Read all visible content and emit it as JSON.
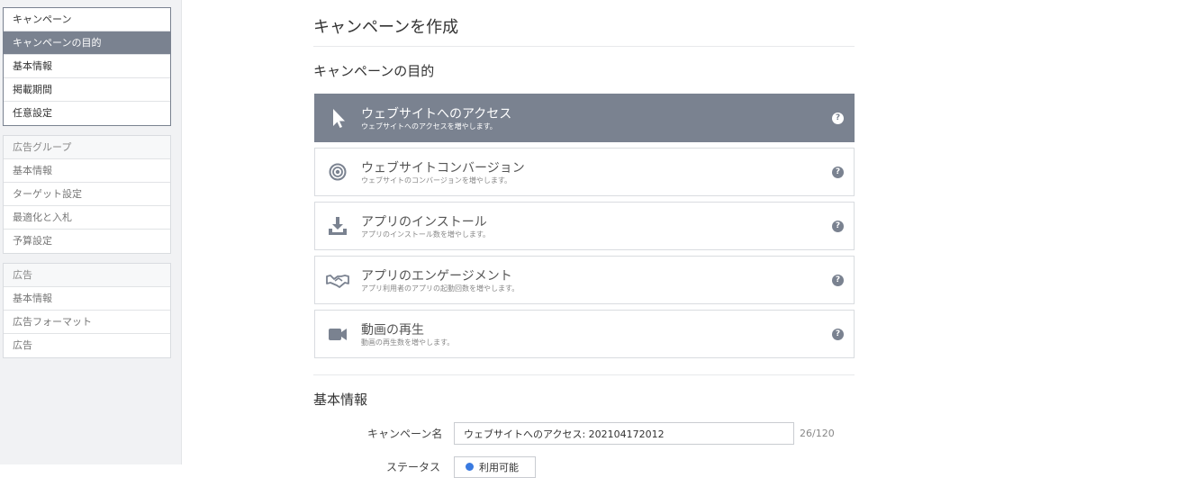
{
  "sidebar": {
    "campaign": [
      "キャンペーン",
      "キャンペーンの目的",
      "基本情報",
      "掲載期間",
      "任意設定"
    ],
    "adgroup": [
      "広告グループ",
      "基本情報",
      "ターゲット設定",
      "最適化と入札",
      "予算設定"
    ],
    "ad": [
      "広告",
      "基本情報",
      "広告フォーマット",
      "広告"
    ]
  },
  "main": {
    "page_title": "キャンペーンを作成",
    "objective_section_title": "キャンペーンの目的",
    "objectives": [
      {
        "title": "ウェブサイトへのアクセス",
        "desc": "ウェブサイトへのアクセスを増やします。",
        "icon": "cursor-icon",
        "selected": true
      },
      {
        "title": "ウェブサイトコンバージョン",
        "desc": "ウェブサイトのコンバージョンを増やします。",
        "icon": "target-icon",
        "selected": false
      },
      {
        "title": "アプリのインストール",
        "desc": "アプリのインストール数を増やします。",
        "icon": "download-icon",
        "selected": false
      },
      {
        "title": "アプリのエンゲージメント",
        "desc": "アプリ利用者のアプリの起動回数を増やします。",
        "icon": "handshake-icon",
        "selected": false
      },
      {
        "title": "動画の再生",
        "desc": "動画の再生数を増やします。",
        "icon": "video-camera-icon",
        "selected": false
      }
    ],
    "help_glyph": "?",
    "basic_section_title": "基本情報",
    "campaign_name_label": "キャンペーン名",
    "campaign_name_value": "ウェブサイトへのアクセス: 202104172012",
    "campaign_name_counter": "26/120",
    "status_label": "ステータス",
    "status_value": "利用可能"
  },
  "colors": {
    "selected_bg": "#7a8290",
    "accent": "#3a7ae0"
  }
}
